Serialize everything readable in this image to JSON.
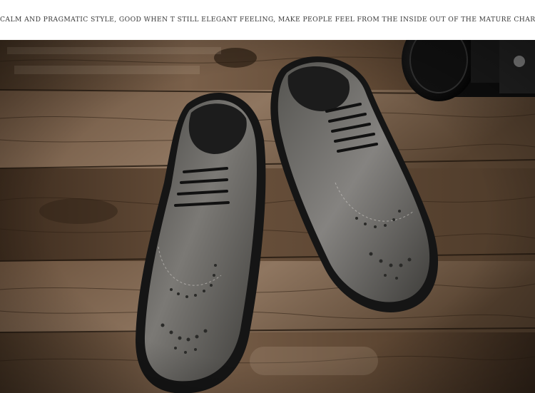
{
  "caption": "CALM AND PRAGMATIC STYLE, GOOD WHEN T STILL ELEGANT FEELING, MAKE PEOPLE FEEL FROM THE INSIDE OUT OF THE MATURE CHARM.",
  "photo": {
    "subject": "pair of grey leather brogue oxford shoes on a wooden floor with a camera lens",
    "colors": {
      "wood_dark": "#3b2a1c",
      "wood_mid": "#6e5540",
      "wood_light": "#9a8066",
      "leather": "#5b5a57",
      "leather_highlight": "#8e8c88",
      "sole": "#141414"
    }
  }
}
